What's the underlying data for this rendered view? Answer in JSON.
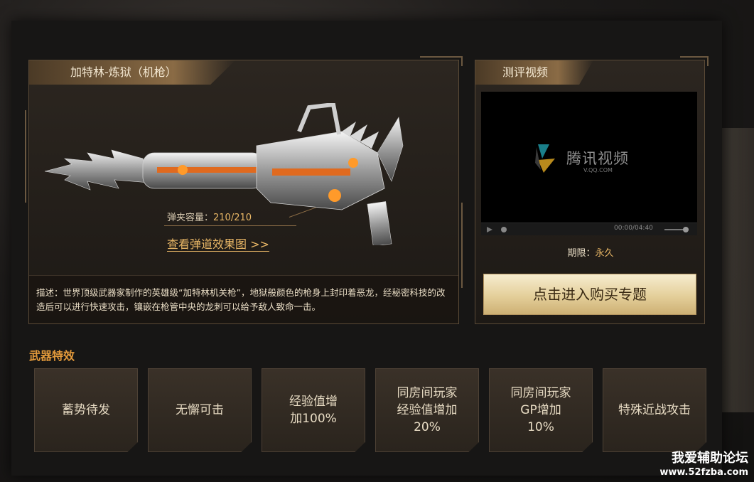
{
  "weapon": {
    "title": "加特林-炼狱（机枪）",
    "ammo_label": "弹夹容量：",
    "ammo_value": "210/210",
    "ballistic_link": "查看弹道效果图 >>",
    "description_label": "描述：",
    "description": "世界顶级武器家制作的英雄级“加特林机关枪”，地狱般颜色的枪身上封印着恶龙，经秘密科技的改造后可以进行快速攻击，镶嵌在枪管中央的龙刺可以给予敌人致命一击。"
  },
  "video": {
    "title": "测评视频",
    "logo_text": "腾讯视频",
    "logo_sub": "V.QQ.COM",
    "time": "00:00/04:40",
    "period_label": "期限：",
    "period_value": "永久",
    "buy_button": "点击进入购买专题"
  },
  "effects": {
    "title": "武器特效",
    "items": [
      "蓄势待发",
      "无懈可击",
      "经验值增\n加100%",
      "同房间玩家\n经验值增加\n20%",
      "同房间玩家\nGP增加\n10%",
      "特殊近战攻击"
    ]
  },
  "watermark": {
    "line1": "我爱辅助论坛",
    "line2": "www.52fzba.com"
  },
  "colors": {
    "accent": "#e9b766",
    "section_title": "#e39a3b"
  }
}
